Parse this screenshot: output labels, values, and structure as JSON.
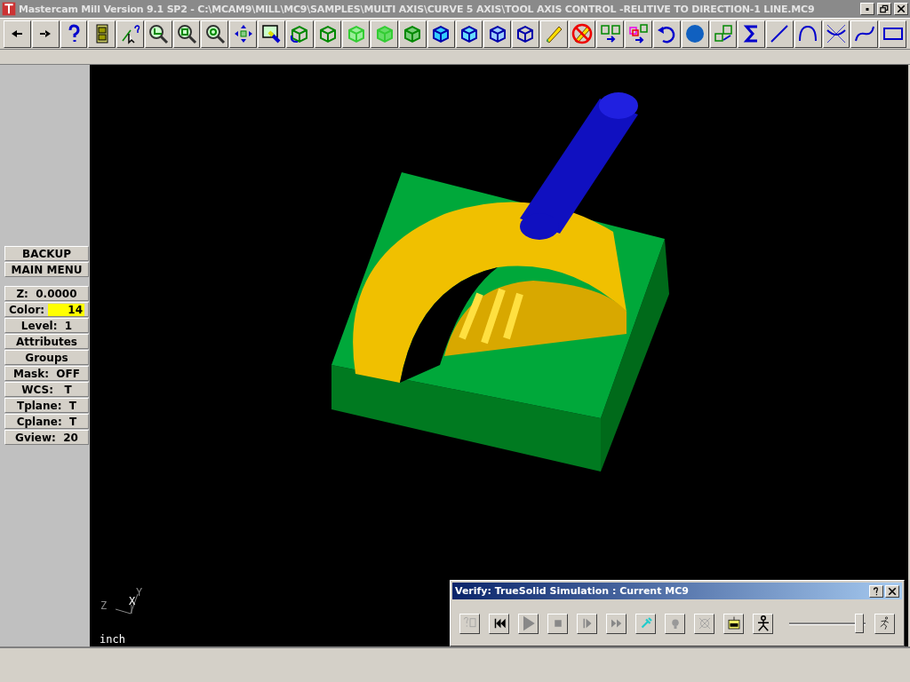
{
  "window": {
    "title": "Mastercam Mill Version 9.1 SP2 - C:\\MCAM9\\MILL\\MC9\\SAMPLES\\MULTI AXIS\\CURVE 5 AXIS\\TOOL AXIS CONTROL -RELITIVE TO DIRECTION-1 LINE.MC9"
  },
  "menu": [
    {
      "label": "BACKUP"
    },
    {
      "label": "MAIN MENU"
    }
  ],
  "settings": [
    {
      "label": "Z:  0.0000"
    },
    {
      "label": "Color:",
      "value": "14"
    },
    {
      "label": "Level:  1"
    },
    {
      "label": "Attributes"
    },
    {
      "label": "Groups"
    },
    {
      "label": "Mask:  OFF"
    },
    {
      "label": "WCS:   T"
    },
    {
      "label": "Tplane:  T"
    },
    {
      "label": "Cplane:  T"
    },
    {
      "label": "Gview:  20"
    }
  ],
  "viewport": {
    "axes": {
      "x": "X",
      "y": "Y",
      "z": "Z"
    },
    "units": "inch"
  },
  "verify_dialog": {
    "title": "Verify: TrueSolid Simulation : Current MC9",
    "speed": {
      "level": 0.97
    }
  }
}
